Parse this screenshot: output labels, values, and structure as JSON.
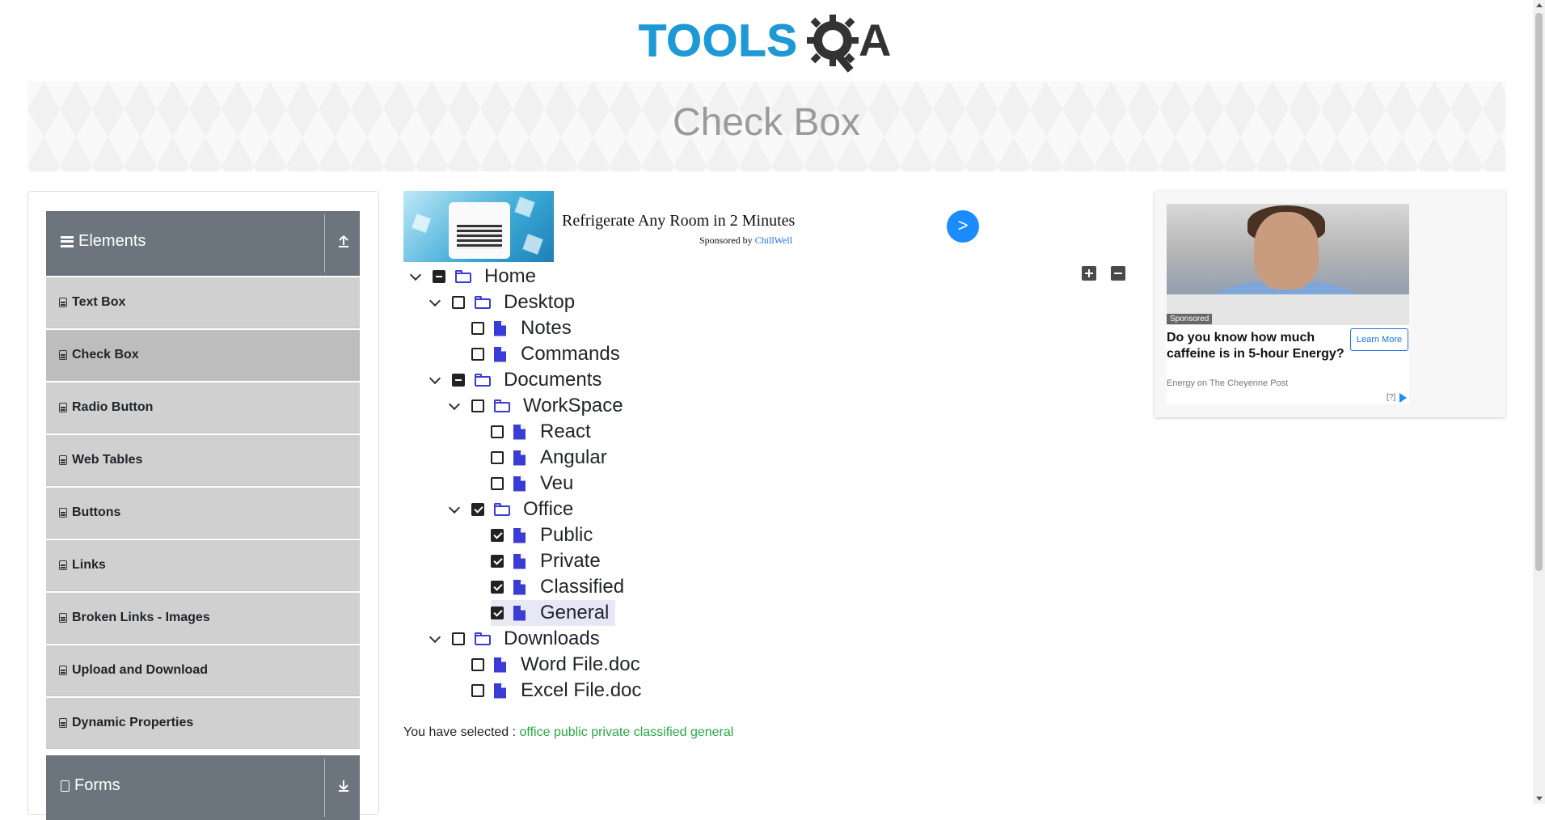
{
  "header": {
    "logo_text": "TOOLS",
    "logo_last": "A"
  },
  "banner": {
    "title": "Check Box"
  },
  "sidebar": {
    "groups": [
      {
        "label": "Elements",
        "icon": "hamburger-icon",
        "toggle_icon": "collapse-arrow-icon"
      },
      {
        "label": "Forms",
        "icon": "document-icon",
        "toggle_icon": "expand-arrow-icon"
      }
    ],
    "items": [
      {
        "label": "Text Box"
      },
      {
        "label": "Check Box"
      },
      {
        "label": "Radio Button"
      },
      {
        "label": "Web Tables"
      },
      {
        "label": "Buttons"
      },
      {
        "label": "Links"
      },
      {
        "label": "Broken Links - Images"
      },
      {
        "label": "Upload and Download"
      },
      {
        "label": "Dynamic Properties"
      }
    ]
  },
  "ad_top": {
    "headline": "Refrigerate Any Room in 2 Minutes",
    "sponsored_prefix": "Sponsored by",
    "sponsor": "ChillWell",
    "go_label": ">"
  },
  "tree": {
    "expand_all_icon": "plus-square-icon",
    "collapse_all_icon": "minus-square-icon",
    "nodes": [
      {
        "label": "Home",
        "type": "folder",
        "state": "half",
        "depth": 0,
        "expanded": true
      },
      {
        "label": "Desktop",
        "type": "folder",
        "state": "unchecked",
        "depth": 1,
        "expanded": true
      },
      {
        "label": "Notes",
        "type": "file",
        "state": "unchecked",
        "depth": 2
      },
      {
        "label": "Commands",
        "type": "file",
        "state": "unchecked",
        "depth": 2
      },
      {
        "label": "Documents",
        "type": "folder",
        "state": "half",
        "depth": 1,
        "expanded": true
      },
      {
        "label": "WorkSpace",
        "type": "folder",
        "state": "unchecked",
        "depth": 2,
        "expanded": true
      },
      {
        "label": "React",
        "type": "file",
        "state": "unchecked",
        "depth": 3
      },
      {
        "label": "Angular",
        "type": "file",
        "state": "unchecked",
        "depth": 3
      },
      {
        "label": "Veu",
        "type": "file",
        "state": "unchecked",
        "depth": 3
      },
      {
        "label": "Office",
        "type": "folder",
        "state": "checked",
        "depth": 2,
        "expanded": true
      },
      {
        "label": "Public",
        "type": "file",
        "state": "checked",
        "depth": 3
      },
      {
        "label": "Private",
        "type": "file",
        "state": "checked",
        "depth": 3
      },
      {
        "label": "Classified",
        "type": "file",
        "state": "checked",
        "depth": 3
      },
      {
        "label": "General",
        "type": "file",
        "state": "checked",
        "depth": 3,
        "highlighted": true
      },
      {
        "label": "Downloads",
        "type": "folder",
        "state": "unchecked",
        "depth": 1,
        "expanded": true
      },
      {
        "label": "Word File.doc",
        "type": "file",
        "state": "unchecked",
        "depth": 2
      },
      {
        "label": "Excel File.doc",
        "type": "file",
        "state": "unchecked",
        "depth": 2
      }
    ]
  },
  "result": {
    "prefix": "You have selected :",
    "selected": [
      "office",
      "public",
      "private",
      "classified",
      "general"
    ]
  },
  "ad_right": {
    "sponsored": "Sponsored",
    "headline": "Do you know how much caffeine is in 5-hour Energy?",
    "source": "Energy on The Cheyenne Post",
    "cta": "Learn More",
    "adchoices": "[?]"
  },
  "colors": {
    "accent_blue": "#1d9ad6",
    "tree_icon": "#3b3bd6",
    "success": "#28a745",
    "sidebar_header": "#6c757d"
  }
}
